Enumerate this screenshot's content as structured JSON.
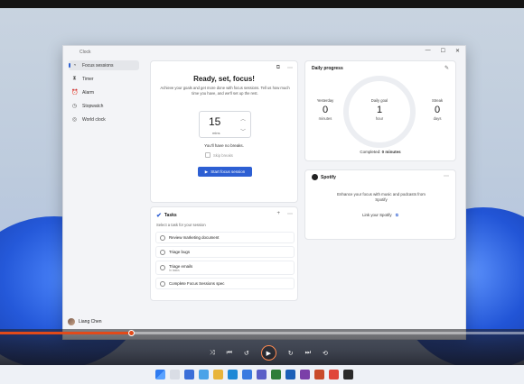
{
  "window": {
    "app_title": "Clock",
    "controls": {
      "minimize": "—",
      "maximize": "☐",
      "close": "✕"
    }
  },
  "sidebar": {
    "items": [
      {
        "label": "Focus sessions",
        "icon": "focus-icon",
        "glyph": "◔",
        "active": true
      },
      {
        "label": "Timer",
        "icon": "timer-icon",
        "glyph": "⧗",
        "active": false
      },
      {
        "label": "Alarm",
        "icon": "alarm-icon",
        "glyph": "⏰",
        "active": false
      },
      {
        "label": "Stopwatch",
        "icon": "stopwatch-icon",
        "glyph": "◷",
        "active": false
      },
      {
        "label": "World clock",
        "icon": "globe-icon",
        "glyph": "◎",
        "active": false
      }
    ],
    "user": {
      "name": "Liang Chen"
    }
  },
  "focus": {
    "title": "Ready, set, focus!",
    "description": "Achieve your goals and get more done with focus sessions. Tell us how much time you have, and we'll set up the rest.",
    "minutes": "15",
    "minutes_unit": "mins",
    "breaks_text": "You'll have no breaks.",
    "skip_breaks": "Skip breaks",
    "start_button": "Start focus session"
  },
  "progress": {
    "title": "Daily progress",
    "yesterday": {
      "label": "Yesterday",
      "value": "0",
      "unit": "minutes"
    },
    "goal": {
      "label": "Daily goal",
      "value": "1",
      "unit": "hour"
    },
    "streak": {
      "label": "Streak",
      "value": "0",
      "unit": "days"
    },
    "completed_label": "Completed:",
    "completed_value": "0 minutes"
  },
  "spotify": {
    "title": "Spotify",
    "text": "Enhance your focus with music and podcasts from Spotify",
    "link": "Link your Spotify"
  },
  "tasks": {
    "title": "Tasks",
    "subtitle": "Select a task for your session",
    "items": [
      {
        "label": "Review marketing document",
        "sub": ""
      },
      {
        "label": "Triage bugs",
        "sub": ""
      },
      {
        "label": "Triage emails",
        "sub": "In tasks"
      },
      {
        "label": "Complete Focus Sessions spec",
        "sub": ""
      }
    ]
  },
  "player": {
    "progress_fraction": 0.25
  },
  "colors": {
    "accent": "#2d5fd3",
    "seek": "#e24a1a"
  }
}
